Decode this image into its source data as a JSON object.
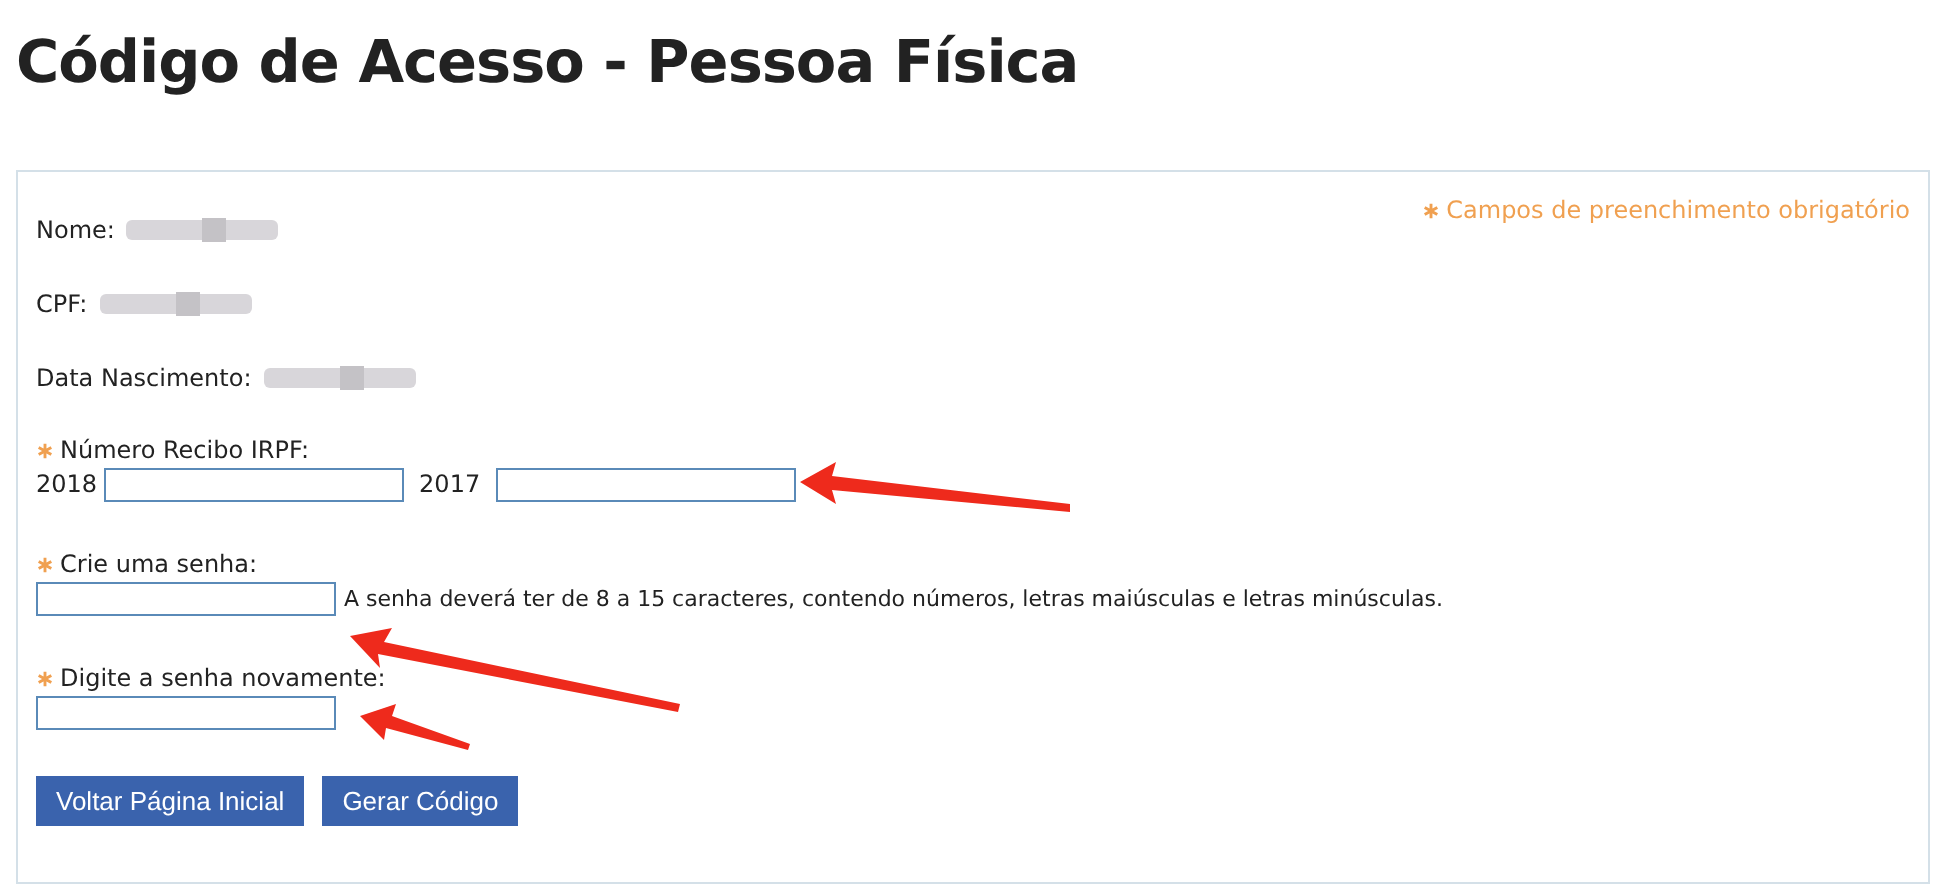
{
  "title": "Código de Acesso - Pessoa Física",
  "required_note": "Campos de preenchimento obrigatório",
  "info": [
    {
      "label": "Nome:"
    },
    {
      "label": "CPF:"
    },
    {
      "label": "Data Nascimento:"
    }
  ],
  "fields": [
    {
      "label": "Número Recibo IRPF:",
      "required": true,
      "kind": "year_inputs",
      "years": [
        "2018",
        "2017"
      ]
    },
    {
      "label": "Crie uma senha:",
      "required": true,
      "kind": "single_input",
      "hint": "A senha deverá ter de 8 a 15 caracteres, contendo números, letras maiúsculas e letras minúsculas."
    },
    {
      "label": "Digite a senha novamente:",
      "required": true,
      "kind": "single_input"
    }
  ],
  "buttons": [
    "Voltar Página Inicial",
    "Gerar Código"
  ]
}
